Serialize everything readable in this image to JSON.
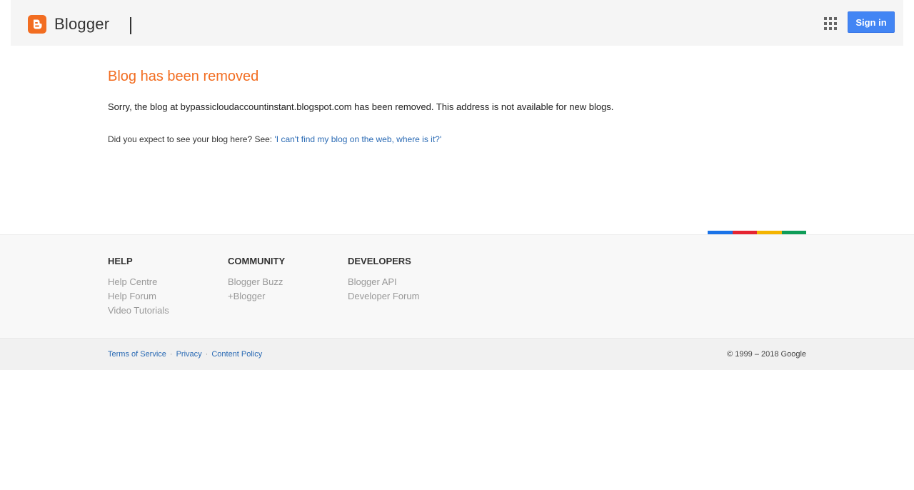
{
  "header": {
    "logo_text": "Blogger",
    "logo_icon": "blogger-b-icon",
    "apps_icon": "apps-grid-icon",
    "signin_label": "Sign in",
    "brand_color": "#f26d21",
    "signin_color": "#4285f4"
  },
  "main": {
    "title": "Blog has been removed",
    "message": "Sorry, the blog at bypassicloudaccountinstant.blogspot.com has been removed. This address is not available for new blogs.",
    "help_prefix": "Did you expect to see your blog here? See: ",
    "help_link": "'I can't find my blog on the web, where is it?'"
  },
  "stripe_colors": [
    "#1a73e8",
    "#e52431",
    "#f4b400",
    "#0f9d58"
  ],
  "footer": {
    "columns": [
      {
        "heading": "HELP",
        "links": [
          "Help Centre",
          "Help Forum",
          "Video Tutorials"
        ]
      },
      {
        "heading": "COMMUNITY",
        "links": [
          "Blogger Buzz",
          "+Blogger"
        ]
      },
      {
        "heading": "DEVELOPERS",
        "links": [
          "Blogger API",
          "Developer Forum"
        ]
      }
    ]
  },
  "legal": {
    "links": [
      "Terms of Service",
      "Privacy",
      "Content Policy"
    ],
    "separator": "·",
    "copyright": "© 1999 – 2018 Google"
  }
}
